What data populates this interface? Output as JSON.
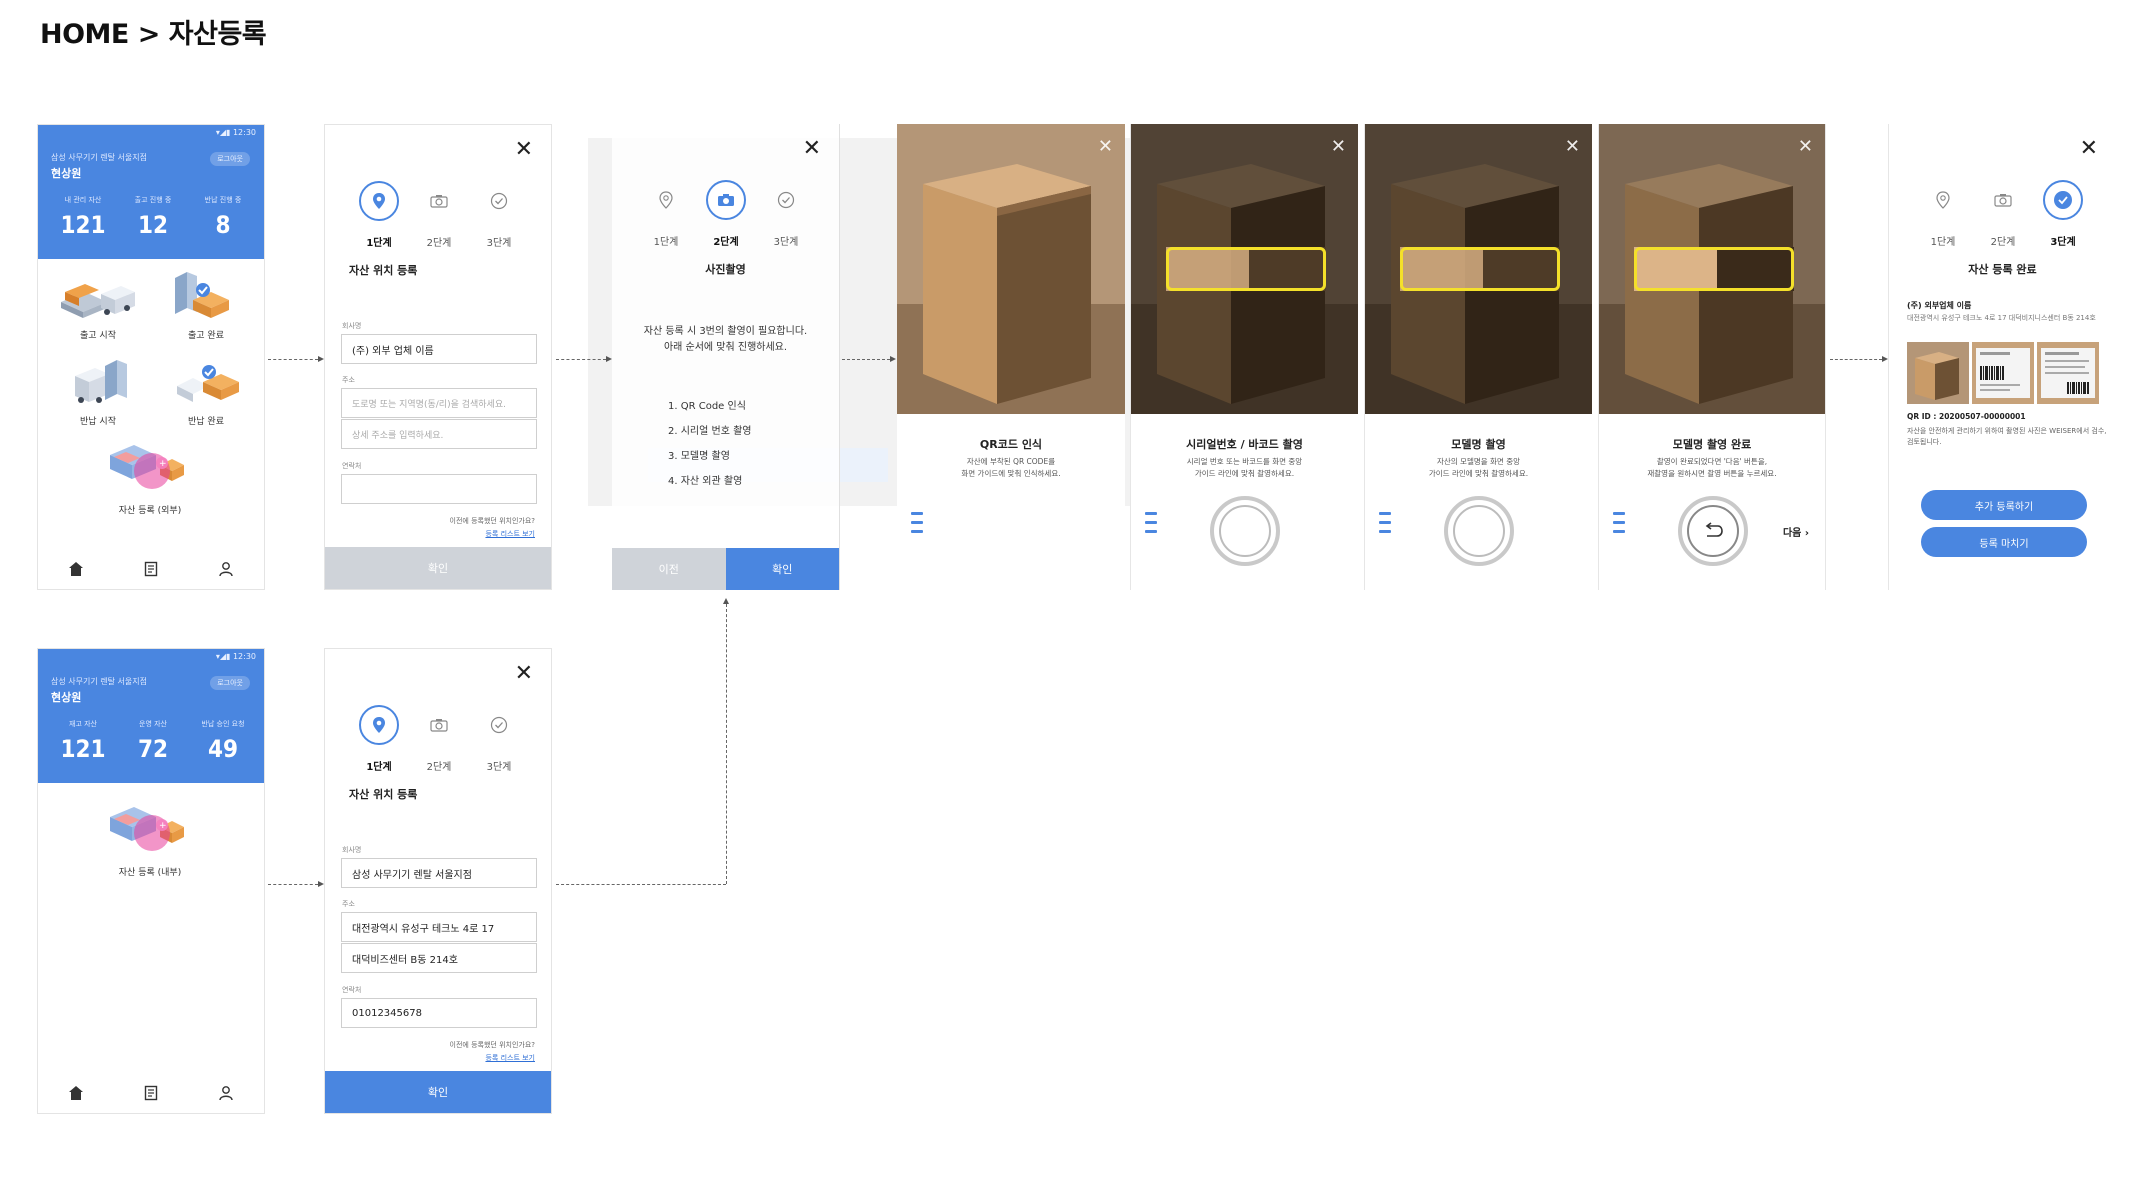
{
  "page_title": "HOME > 자산등록",
  "colors": {
    "primary": "#4a86e0",
    "button_disabled": "#cfd3d9",
    "guide_box": "#f4e02a",
    "link": "#2f6fd6"
  },
  "home_a": {
    "statusbar_time": "12:30",
    "company": "삼성 사무기기 렌탈 서울지점",
    "user": "현상원",
    "logout": "로그아웃",
    "stats": [
      {
        "label": "내 관리 자산",
        "value": "121"
      },
      {
        "label": "출고 진행 중",
        "value": "12"
      },
      {
        "label": "반납 진행 중",
        "value": "8"
      }
    ],
    "menu": [
      {
        "label": "출고 시작",
        "icon": "truck-warehouse-icon"
      },
      {
        "label": "출고 완료",
        "icon": "warehouse-check-icon"
      },
      {
        "label": "반납 시작",
        "icon": "return-truck-icon"
      },
      {
        "label": "반납 완료",
        "icon": "return-check-icon"
      },
      {
        "label": "자산 등록 (외부)",
        "icon": "asset-register-icon"
      }
    ],
    "nav": [
      "home-icon",
      "list-icon",
      "user-icon"
    ]
  },
  "home_b": {
    "statusbar_time": "12:30",
    "company": "삼성 사무기기 렌탈 서울지점",
    "user": "현상원",
    "logout": "로그아웃",
    "stats": [
      {
        "label": "재고 자산",
        "value": "121"
      },
      {
        "label": "운영 자산",
        "value": "72"
      },
      {
        "label": "반납 승인 요청",
        "value": "49"
      }
    ],
    "menu_label": "자산 등록 (내부)",
    "nav": [
      "home-icon",
      "list-icon",
      "user-icon"
    ]
  },
  "steps": [
    "1단계",
    "2단계",
    "3단계"
  ],
  "step1_a": {
    "title": "자산 위치 등록",
    "company_label": "회사명",
    "company_value": "(주) 외부 업체 이름",
    "address_label": "주소",
    "address_placeholder": "도로명 또는 지역명(동/리)을 검색하세요.",
    "address_detail_placeholder": "상세 주소를 입력하세요.",
    "contact_label": "연락처",
    "contact_value": "",
    "hint_question": "이전에 등록했던 위치인가요?",
    "hint_link": "등록 리스트 보기",
    "confirm": "확인"
  },
  "step1_b": {
    "title": "자산 위치 등록",
    "company_label": "회사명",
    "company_value": "삼성 사무기기 렌탈 서울지점",
    "address_label": "주소",
    "address_value": "대전광역시 유성구 테크노 4로 17",
    "address_detail_value": "대덕비즈센터 B동 214호",
    "contact_label": "연락처",
    "contact_value": "01012345678",
    "hint_question": "이전에 등록했던 위치인가요?",
    "hint_link": "등록 리스트 보기",
    "confirm": "확인"
  },
  "step2": {
    "title": "사진촬영",
    "intro_line1": "자산 등록 시 3번의 촬영이 필요합니다.",
    "intro_line2": "아래 순서에 맞춰 진행하세요.",
    "items": [
      "1. QR Code 인식",
      "2. 시리얼 번호 촬영",
      "3. 모델명 촬영",
      "4. 자산 외관 촬영"
    ],
    "prev": "이전",
    "confirm": "확인"
  },
  "camera": [
    {
      "title": "QR코드 인식",
      "desc1": "자산에 부착된 QR CODE를",
      "desc2": "화면 가이드에 맞춰 인식하세요."
    },
    {
      "title": "시리얼번호 / 바코드 촬영",
      "desc1": "시리얼 번호 또는 바코드를 화면 중앙",
      "desc2": "가이드 라인에 맞춰 촬영하세요."
    },
    {
      "title": "모델명 촬영",
      "desc1": "자산의 모델명을 화면 중앙",
      "desc2": "가이드 라인에 맞춰 촬영하세요."
    },
    {
      "title": "모델명 촬영 완료",
      "desc1": "촬영이 완료되었다면 '다음' 버튼을,",
      "desc2": "재촬영을 원하시면 촬영 버튼을 누르세요.",
      "next": "다음"
    }
  ],
  "step3": {
    "title": "자산 등록 완료",
    "company": "(주) 외부업체 이름",
    "address": "대전광역시 유성구 테크노 4로 17 대덕비지니스센터 B동 214호",
    "qr_id": "QR ID : 20200507-00000001",
    "note": "자산을 안전하게 관리하기 위하여 촬영된 사진은 WEISER에서 검수, 검토됩니다.",
    "add_more": "추가 등록하기",
    "finish": "등록 마치기"
  }
}
